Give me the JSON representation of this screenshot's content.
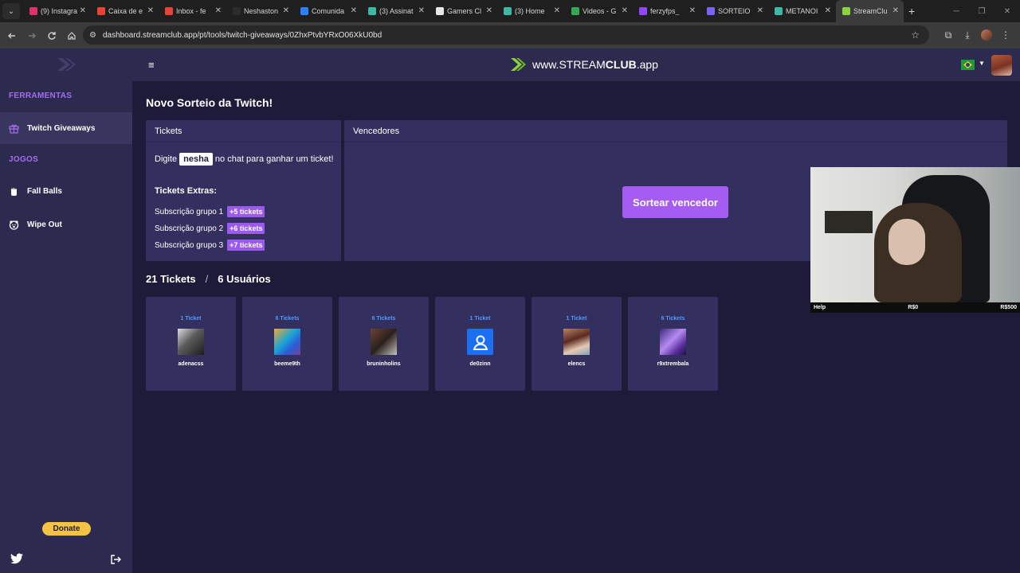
{
  "browser": {
    "tabs": [
      {
        "title": "(9) Instagra",
        "favicon_color": "#e1306c",
        "active": false
      },
      {
        "title": "Caixa de e",
        "favicon_color": "#ea4335",
        "active": false
      },
      {
        "title": "Inbox - fe",
        "favicon_color": "#ea4335",
        "active": false
      },
      {
        "title": "Neshaston",
        "favicon_color": "#2c2c2c",
        "active": false
      },
      {
        "title": "Comunida",
        "favicon_color": "#2a80ff",
        "active": false
      },
      {
        "title": "(3) Assinat",
        "favicon_color": "#3fb7a7",
        "active": false
      },
      {
        "title": "Gamers Cl",
        "favicon_color": "#e8e8e8",
        "active": false
      },
      {
        "title": "(3) Home",
        "favicon_color": "#3fb7a7",
        "active": false
      },
      {
        "title": "Videos - G",
        "favicon_color": "#34a853",
        "active": false
      },
      {
        "title": "ferzyfps_",
        "favicon_color": "#9146ff",
        "active": false
      },
      {
        "title": "SORTEIO",
        "favicon_color": "#7b61ff",
        "active": false
      },
      {
        "title": "METANOI",
        "favicon_color": "#3fb7a7",
        "active": false
      },
      {
        "title": "StreamClu",
        "favicon_color": "#8bd33c",
        "active": true
      }
    ],
    "url": "dashboard.streamclub.app/pt/tools/twitch-giveaways/0ZhxPtvbYRxO06XkU0bd"
  },
  "sidebar": {
    "section_tools": "FERRAMENTAS",
    "tools": [
      {
        "label": "Twitch Giveaways",
        "icon": "gift-icon"
      }
    ],
    "section_games": "JOGOS",
    "games": [
      {
        "label": "Fall Balls",
        "icon": "fist-icon"
      },
      {
        "label": "Wipe Out",
        "icon": "bear-icon"
      }
    ],
    "donate_label": "Donate"
  },
  "header": {
    "brand_prefix": "www.STREAM",
    "brand_bold": "CLUB",
    "brand_suffix": ".app",
    "language": "pt-BR",
    "accent_color": "#8bd33c"
  },
  "main": {
    "title": "Novo Sorteio da Twitch!",
    "tickets_card": {
      "heading": "Tickets",
      "instruction_before": "Digite",
      "keyword": "nesha",
      "instruction_after": "no chat para ganhar um ticket!",
      "extras_title": "Tickets Extras:",
      "extras": [
        {
          "label": "Subscrição grupo 1",
          "badge": "+5 tickets"
        },
        {
          "label": "Subscrição grupo 2",
          "badge": "+6 tickets"
        },
        {
          "label": "Subscrição grupo 3",
          "badge": "+7 tickets"
        }
      ]
    },
    "winners_card": {
      "heading": "Vencedores",
      "draw_button": "Sortear vencedor"
    },
    "counts": {
      "tickets": "21 Tickets",
      "separator": "/",
      "users": "6 Usuários"
    },
    "participants": [
      {
        "tickets": "1 Ticket",
        "name": "adenacss",
        "avatar": "photo-dark"
      },
      {
        "tickets": "6 Tickets",
        "name": "beeme9th",
        "avatar": "photo-colorful"
      },
      {
        "tickets": "6 Tickets",
        "name": "bruninholins",
        "avatar": "photo-dark"
      },
      {
        "tickets": "1 Ticket",
        "name": "de0zinn",
        "avatar": "default-user-icon"
      },
      {
        "tickets": "1 Ticket",
        "name": "elencs",
        "avatar": "photo-person"
      },
      {
        "tickets": "6 Tickets",
        "name": "r9xtrembala",
        "avatar": "photo-purple"
      }
    ]
  },
  "webcam": {
    "left_label": "Help",
    "middle_label": "R$0",
    "right_label": "R$500"
  },
  "colors": {
    "background": "#1e1b3a",
    "panel": "#2d2a4f",
    "card": "#332f5e",
    "primary_button": "#a45cf2",
    "badge": "#9b59ef",
    "section_heading": "#a66cf0",
    "ticket_count": "#4e9cff",
    "donate": "#f5c344"
  }
}
